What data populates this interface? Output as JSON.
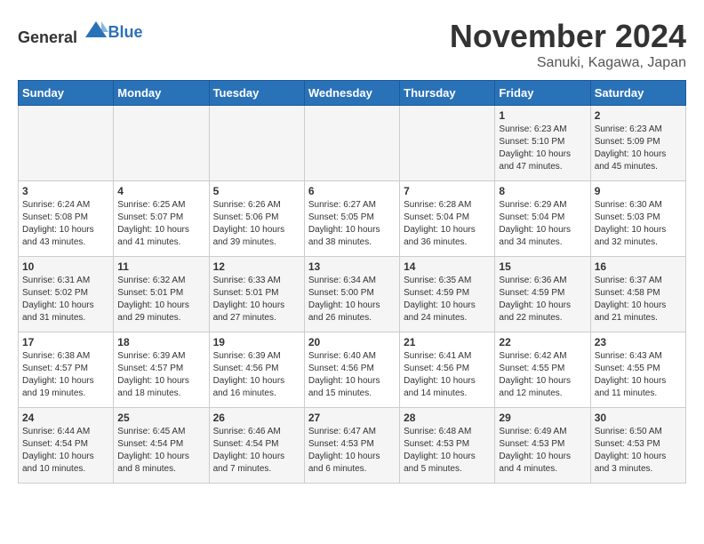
{
  "header": {
    "logo_general": "General",
    "logo_blue": "Blue",
    "month_title": "November 2024",
    "location": "Sanuki, Kagawa, Japan"
  },
  "weekdays": [
    "Sunday",
    "Monday",
    "Tuesday",
    "Wednesday",
    "Thursday",
    "Friday",
    "Saturday"
  ],
  "weeks": [
    [
      {
        "day": "",
        "info": ""
      },
      {
        "day": "",
        "info": ""
      },
      {
        "day": "",
        "info": ""
      },
      {
        "day": "",
        "info": ""
      },
      {
        "day": "",
        "info": ""
      },
      {
        "day": "1",
        "info": "Sunrise: 6:23 AM\nSunset: 5:10 PM\nDaylight: 10 hours\nand 47 minutes."
      },
      {
        "day": "2",
        "info": "Sunrise: 6:23 AM\nSunset: 5:09 PM\nDaylight: 10 hours\nand 45 minutes."
      }
    ],
    [
      {
        "day": "3",
        "info": "Sunrise: 6:24 AM\nSunset: 5:08 PM\nDaylight: 10 hours\nand 43 minutes."
      },
      {
        "day": "4",
        "info": "Sunrise: 6:25 AM\nSunset: 5:07 PM\nDaylight: 10 hours\nand 41 minutes."
      },
      {
        "day": "5",
        "info": "Sunrise: 6:26 AM\nSunset: 5:06 PM\nDaylight: 10 hours\nand 39 minutes."
      },
      {
        "day": "6",
        "info": "Sunrise: 6:27 AM\nSunset: 5:05 PM\nDaylight: 10 hours\nand 38 minutes."
      },
      {
        "day": "7",
        "info": "Sunrise: 6:28 AM\nSunset: 5:04 PM\nDaylight: 10 hours\nand 36 minutes."
      },
      {
        "day": "8",
        "info": "Sunrise: 6:29 AM\nSunset: 5:04 PM\nDaylight: 10 hours\nand 34 minutes."
      },
      {
        "day": "9",
        "info": "Sunrise: 6:30 AM\nSunset: 5:03 PM\nDaylight: 10 hours\nand 32 minutes."
      }
    ],
    [
      {
        "day": "10",
        "info": "Sunrise: 6:31 AM\nSunset: 5:02 PM\nDaylight: 10 hours\nand 31 minutes."
      },
      {
        "day": "11",
        "info": "Sunrise: 6:32 AM\nSunset: 5:01 PM\nDaylight: 10 hours\nand 29 minutes."
      },
      {
        "day": "12",
        "info": "Sunrise: 6:33 AM\nSunset: 5:01 PM\nDaylight: 10 hours\nand 27 minutes."
      },
      {
        "day": "13",
        "info": "Sunrise: 6:34 AM\nSunset: 5:00 PM\nDaylight: 10 hours\nand 26 minutes."
      },
      {
        "day": "14",
        "info": "Sunrise: 6:35 AM\nSunset: 4:59 PM\nDaylight: 10 hours\nand 24 minutes."
      },
      {
        "day": "15",
        "info": "Sunrise: 6:36 AM\nSunset: 4:59 PM\nDaylight: 10 hours\nand 22 minutes."
      },
      {
        "day": "16",
        "info": "Sunrise: 6:37 AM\nSunset: 4:58 PM\nDaylight: 10 hours\nand 21 minutes."
      }
    ],
    [
      {
        "day": "17",
        "info": "Sunrise: 6:38 AM\nSunset: 4:57 PM\nDaylight: 10 hours\nand 19 minutes."
      },
      {
        "day": "18",
        "info": "Sunrise: 6:39 AM\nSunset: 4:57 PM\nDaylight: 10 hours\nand 18 minutes."
      },
      {
        "day": "19",
        "info": "Sunrise: 6:39 AM\nSunset: 4:56 PM\nDaylight: 10 hours\nand 16 minutes."
      },
      {
        "day": "20",
        "info": "Sunrise: 6:40 AM\nSunset: 4:56 PM\nDaylight: 10 hours\nand 15 minutes."
      },
      {
        "day": "21",
        "info": "Sunrise: 6:41 AM\nSunset: 4:56 PM\nDaylight: 10 hours\nand 14 minutes."
      },
      {
        "day": "22",
        "info": "Sunrise: 6:42 AM\nSunset: 4:55 PM\nDaylight: 10 hours\nand 12 minutes."
      },
      {
        "day": "23",
        "info": "Sunrise: 6:43 AM\nSunset: 4:55 PM\nDaylight: 10 hours\nand 11 minutes."
      }
    ],
    [
      {
        "day": "24",
        "info": "Sunrise: 6:44 AM\nSunset: 4:54 PM\nDaylight: 10 hours\nand 10 minutes."
      },
      {
        "day": "25",
        "info": "Sunrise: 6:45 AM\nSunset: 4:54 PM\nDaylight: 10 hours\nand 8 minutes."
      },
      {
        "day": "26",
        "info": "Sunrise: 6:46 AM\nSunset: 4:54 PM\nDaylight: 10 hours\nand 7 minutes."
      },
      {
        "day": "27",
        "info": "Sunrise: 6:47 AM\nSunset: 4:53 PM\nDaylight: 10 hours\nand 6 minutes."
      },
      {
        "day": "28",
        "info": "Sunrise: 6:48 AM\nSunset: 4:53 PM\nDaylight: 10 hours\nand 5 minutes."
      },
      {
        "day": "29",
        "info": "Sunrise: 6:49 AM\nSunset: 4:53 PM\nDaylight: 10 hours\nand 4 minutes."
      },
      {
        "day": "30",
        "info": "Sunrise: 6:50 AM\nSunset: 4:53 PM\nDaylight: 10 hours\nand 3 minutes."
      }
    ]
  ]
}
